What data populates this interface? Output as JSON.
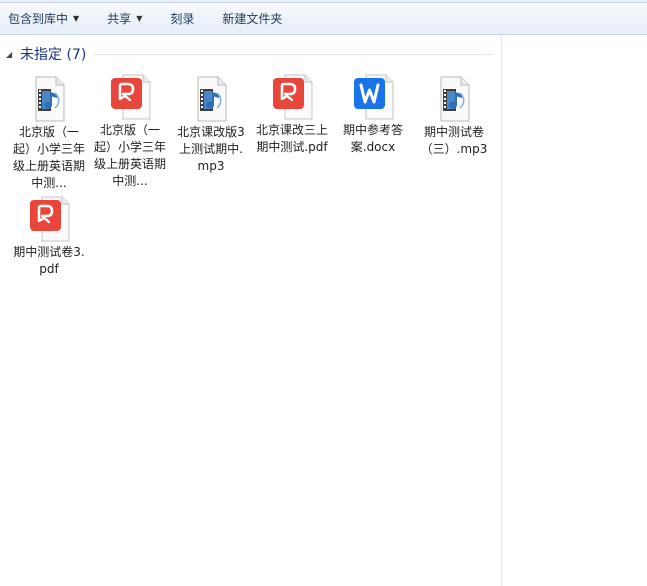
{
  "toolbar": {
    "include_library": "包含到库中",
    "share": "共享",
    "burn": "刻录",
    "new_folder": "新建文件夹"
  },
  "group": {
    "title": "未指定 (7)"
  },
  "files": [
    {
      "label": "北京版（一起）小学三年级上册英语期中测...",
      "icon": "audio-file-icon"
    },
    {
      "label": "北京版（一起）小学三年级上册英语期中测...",
      "icon": "pdf-file-icon"
    },
    {
      "label": "北京课改版3上测试期中.mp3",
      "icon": "audio-file-icon"
    },
    {
      "label": "北京课改三上 期中测试.pdf",
      "icon": "pdf-file-icon"
    },
    {
      "label": "期中参考答案.docx",
      "icon": "word-file-icon"
    },
    {
      "label": "期中测试卷（三）.mp3",
      "icon": "audio-file-icon"
    },
    {
      "label": "期中测试卷3.pdf",
      "icon": "pdf-file-icon"
    }
  ],
  "colors": {
    "pdf_red": "#e8463b",
    "word_blue": "#1a73e8",
    "audio_blue": "#2f6fb5",
    "group_title": "#1e3287"
  }
}
